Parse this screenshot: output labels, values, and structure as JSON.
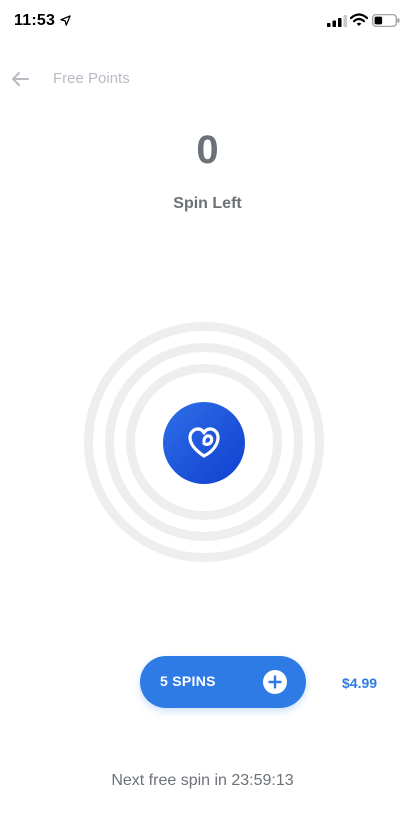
{
  "status_bar": {
    "time": "11:53"
  },
  "header": {
    "title": "Free Points"
  },
  "spins": {
    "count": "0",
    "label": "Spin Left"
  },
  "purchase": {
    "button_label": "5 SPINS",
    "price": "$4.99"
  },
  "footer": {
    "next_free_label": "Next free spin in 23:59:13"
  },
  "colors": {
    "accent": "#2f7be6",
    "spin_button_gradient_start": "#2f6fe8",
    "spin_button_gradient_end": "#0f3fcf",
    "ring": "#eeeeee",
    "text_gray": "#6c7178",
    "nav_gray": "#b7bcc3"
  },
  "icons": [
    "location-arrow-icon",
    "signal-icon",
    "wifi-icon",
    "battery-icon",
    "back-arrow-icon",
    "heart-logo-icon",
    "plus-icon"
  ]
}
